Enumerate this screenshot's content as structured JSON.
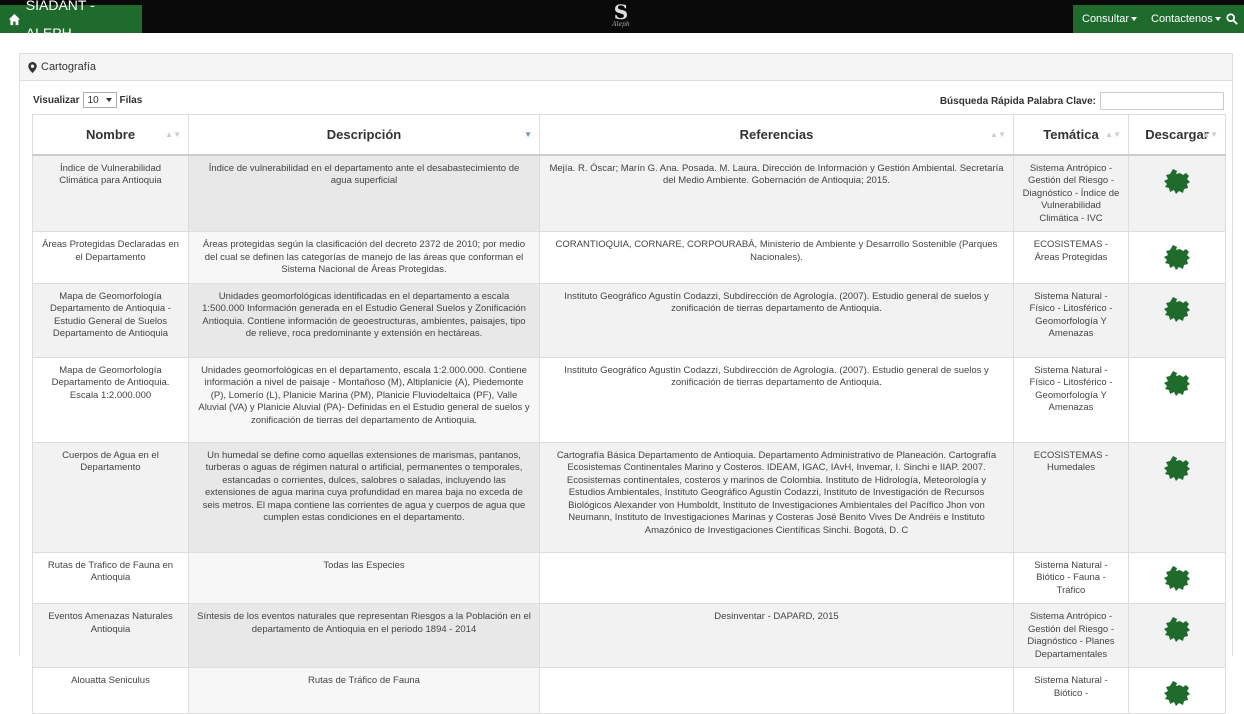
{
  "nav": {
    "brand": "SIADANT - ALEPH",
    "logo_letter": "S",
    "logo_sub": "Aleph",
    "consultar": "Consultar",
    "contactenos": "Contactenos"
  },
  "panel": {
    "title": "Cartografía"
  },
  "controls": {
    "visualizar": "Visualizar",
    "page_length": "10",
    "filas": "Filas",
    "search_label": "Búsqueda Rápida Palabra Clave:",
    "search_value": ""
  },
  "columns": [
    "Nombre",
    "Descripción",
    "Referencias",
    "Temática",
    "Descargar"
  ],
  "rows": [
    {
      "nombre": "Índice de Vulnerabilidad Climática para Antioquia",
      "descripcion": "Índice de vulnerabilidad en el departamento ante el desabastecimiento de agua superficial",
      "referencias": "Mejía. R. Óscar; Marín G. Ana. Posada. M. Laura. Dirección de Información y Gestión Ambiental. Secretaría del Medio Ambiente. Gobernación de Antioquia; 2015.",
      "tematica": "Sistema Antrópico - Gestión del Riesgo - Diagnóstico - Índice de Vulnerabilidad Climática - IVC"
    },
    {
      "nombre": "Áreas Protegidas Declaradas en el Departamento",
      "descripcion": "Áreas protegidas según la clasificación del decreto 2372 de 2010; por medio del cual se definen las categorías de manejo de las áreas que conforman el Sistema Nacional de Áreas Protegidas.",
      "referencias": "CORANTIOQUIA, CORNARE, CORPOURABÁ, Ministerio de Ambiente y Desarrollo Sostenible (Parques Nacionales).",
      "tematica": "ECOSISTEMAS - Áreas Protegidas"
    },
    {
      "nombre": "Mapa de Geomorfología Departamento de Antioquia - Estudio General de Suelos Departamento de Antioquia",
      "descripcion": "Unidades geomorfológicas identificadas en el departamento a escala 1:500.000 Información generada en el Estudio General Suelos y Zonificación Antioquia. Contiene información de geoestructuras, ambientes, paisajes, tipo de relieve, roca predominante y extensión en hectáreas.",
      "referencias": "Instituto Geográfico Agustín Codazzi, Subdirección de Agrología. (2007). Estudio general de suelos y zonificación de tierras departamento de Antioquia.",
      "tematica": "Sistema Natural - Físico - Litosférico - Geomorfología Y Amenazas"
    },
    {
      "nombre": "Mapa de Geomorfología Departamento de Antioquia. Escala 1:2.000.000",
      "descripcion": "Unidades geomorfológicas en el departamento, escala 1:2.000.000. Contiene información a nivel de paisaje - Montañoso (M), Altiplanicie (A), Piedemonte (P), Lomerío (L), Planicie Marina (PM), Planicie Fluviodeltaica (PF), Valle Aluvial (VA) y Planicie Aluvial (PA)- Definidas en el Estudio general de suelos y zonificación de tierras del departamento de Antioquia.",
      "referencias": "Instituto Geográfico Agustín Codazzi, Subdirección de Agrología. (2007). Estudio general de suelos y zonificación de tierras departamento de Antioquia.",
      "tematica": "Sistema Natural - Físico - Litosférico - Geomorfología Y Amenazas"
    },
    {
      "nombre": "Cuerpos de Agua en el Departamento",
      "descripcion": "Un humedal se define como aquellas extensiones de marismas, pantanos, turberas o aguas de régimen natural o artificial, permanentes o temporales, estancadas o corrientes, dulces, salobres o saladas, incluyendo las extensiones de agua marina cuya profundidad en marea baja no exceda de seis metros. El mapa contiene las corrientes de agua y cuerpos de agua que cumplen estas condiciones en el departamento.",
      "referencias": "Cartografía Básica Departamento de Antioquia. Departamento Administrativo de Planeación. Cartografía Ecosistemas Continentales Marino y Costeros. IDEAM, IGAC, IAvH, Invemar, I. Sinchi e IIAP. 2007. Ecosistemas continentales, costeros y marinos de Colombia. Instituto de Hidrología, Meteorología y Estudios Ambientales, Instituto Geográfico Agustín Codazzi, Instituto de Investigación de Recursos Biológicos Alexander von Humboldt, Instituto de Investigaciones Ambientales del Pacífico Jhon von Neumann, Instituto de Investigaciones Marinas y Costeras José Benito Vives De Andréis e Instituto Amazónico de Investigaciones Científicas Sinchi. Bogotá, D. C",
      "tematica": "ECOSISTEMAS - Humedales"
    },
    {
      "nombre": "Rutas de Trafico de Fauna en Antioquia",
      "descripcion": "Todas las Especies",
      "referencias": "",
      "tematica": "Sistema Natural - Biótico - Fauna - Tráfico"
    },
    {
      "nombre": "Eventos Amenazas Naturales Antioquia",
      "descripcion": "Síntesis de los eventos naturales que representan Riesgos a la Población en el departamento de Antioquia en el periodo 1894 - 2014",
      "referencias": "Desinventar - DAPARD, 2015",
      "tematica": "Sistema Antrópico - Gestión del Riesgo - Diagnóstico - Planes Departamentales"
    },
    {
      "nombre": "Alouatta Seniculus",
      "descripcion": "Rutas de Tráfico de Fauna",
      "referencias": "",
      "tematica": "Sistema Natural - Biótico -"
    }
  ],
  "icons": {
    "brand": "home-icon",
    "panel": "map-marker-icon",
    "nav_search": "search-icon",
    "download": "antioquia-map-icon"
  },
  "colors": {
    "brand_green": "#1f6b2e",
    "navbar": "#0a0a0a",
    "map_icon": "#1e6b2c"
  }
}
